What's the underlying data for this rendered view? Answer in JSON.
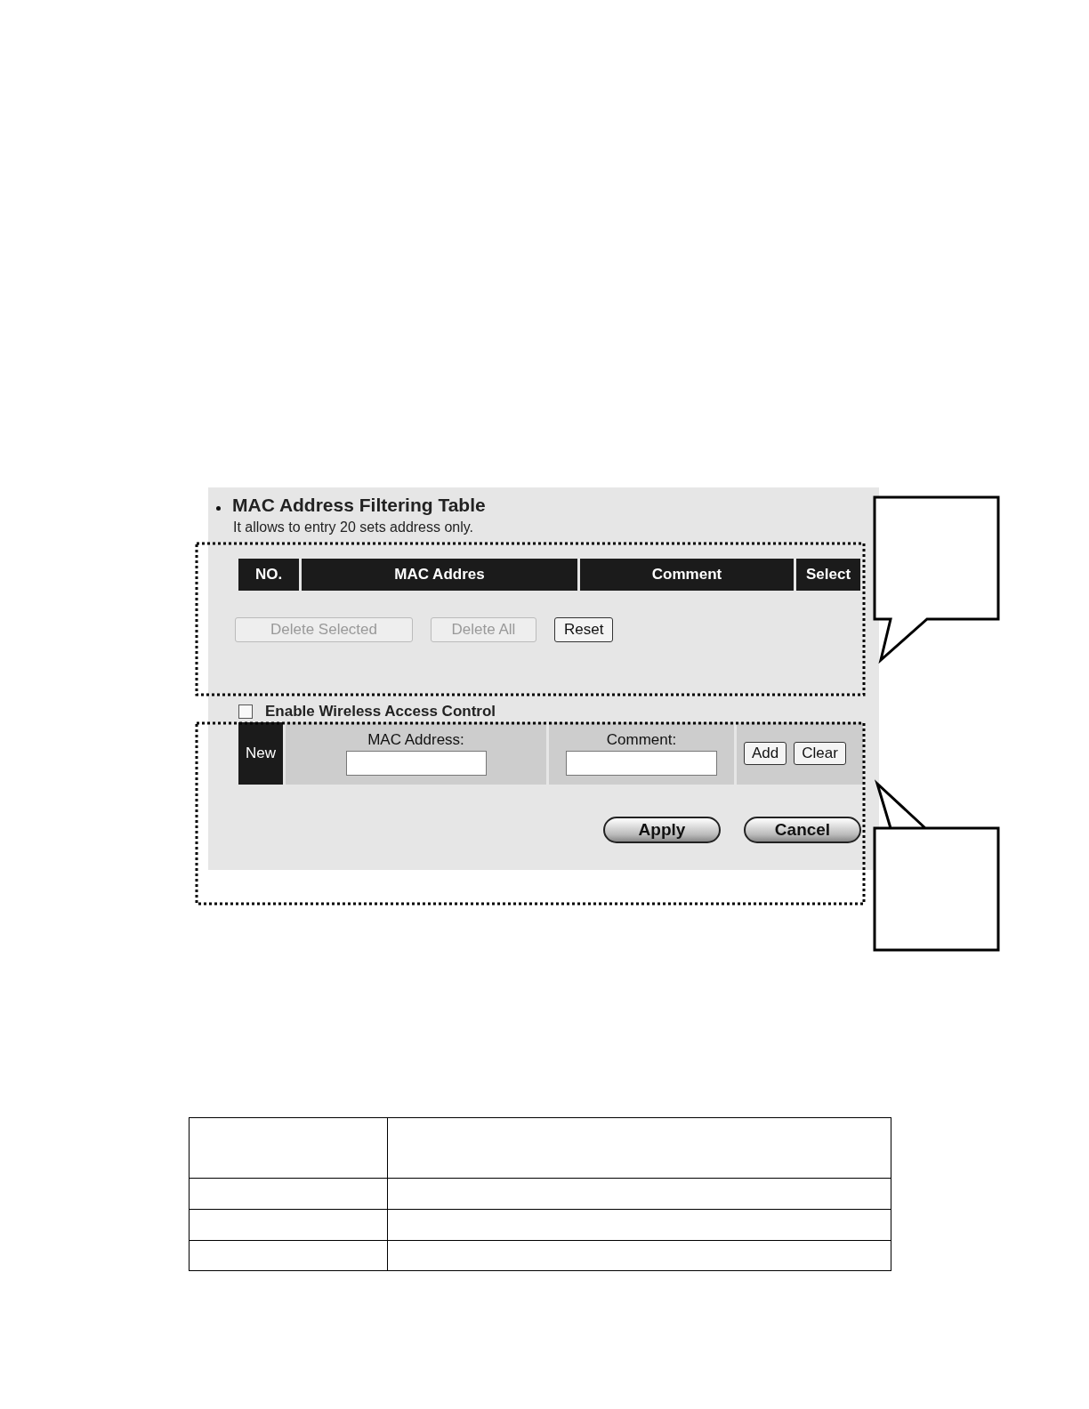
{
  "panel": {
    "title": "MAC Address Filtering Table",
    "note": "It allows to entry 20 sets address only.",
    "table": {
      "columns": [
        "NO.",
        "MAC Addres",
        "Comment",
        "Select"
      ]
    },
    "table_buttons": [
      {
        "label": "Delete Selected",
        "disabled": true
      },
      {
        "label": "Delete All",
        "disabled": true
      },
      {
        "label": "Reset",
        "disabled": false
      }
    ],
    "enable_checkbox": {
      "label": "Enable Wireless Access Control",
      "checked": false
    },
    "new_entry": {
      "row_label": "New",
      "fields": [
        {
          "label": "MAC Address:"
        },
        {
          "label": "Comment:"
        }
      ],
      "buttons": [
        "Add",
        "Clear"
      ]
    },
    "actions": [
      "Apply",
      "Cancel"
    ]
  }
}
